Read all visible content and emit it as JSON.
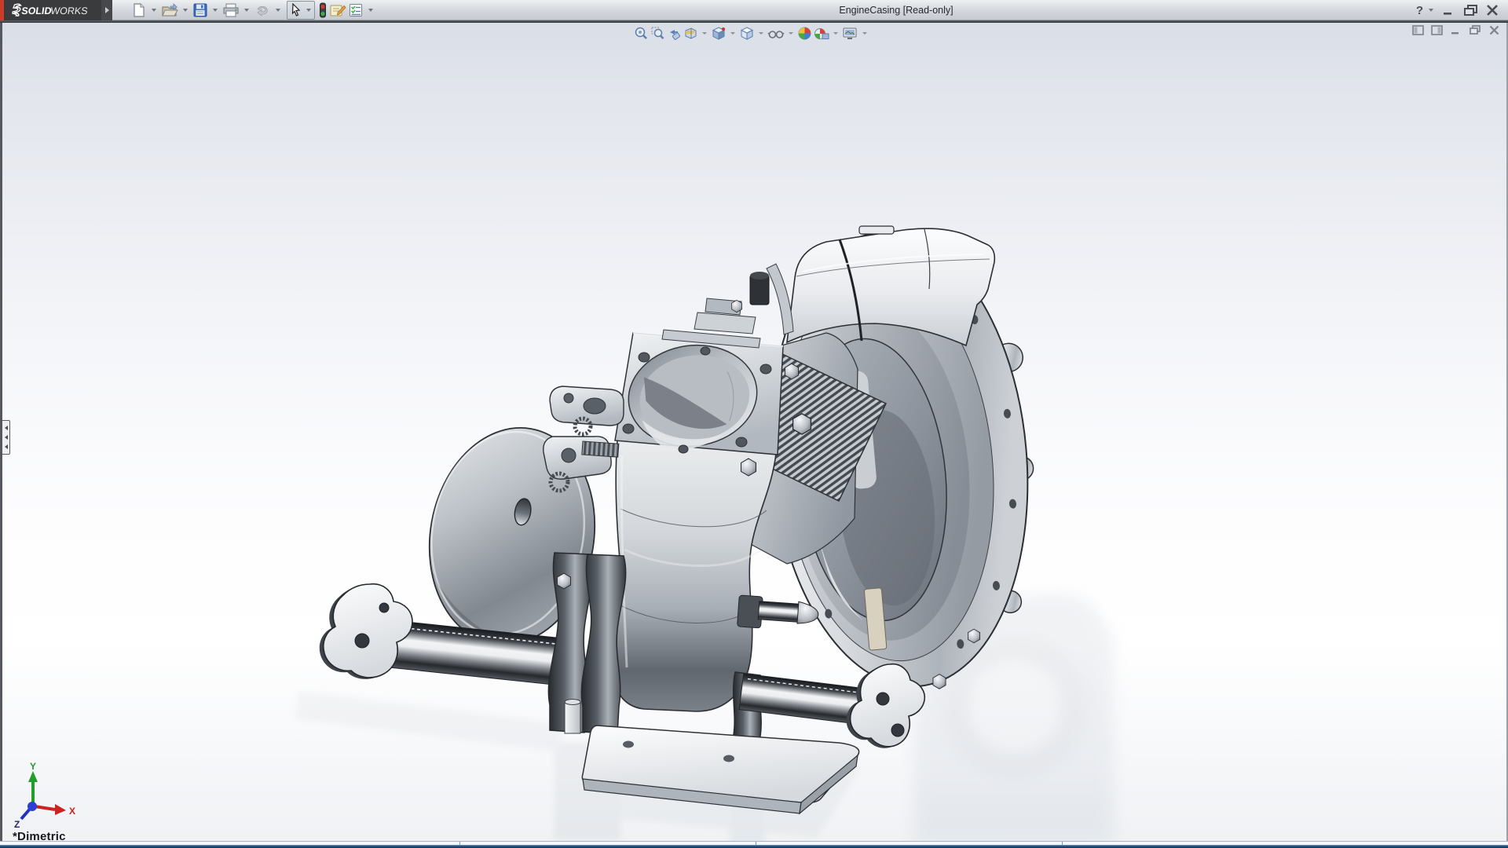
{
  "window": {
    "title": "EngineCasing [Read-only]",
    "logo": {
      "brand_bold": "SOLID",
      "brand_light": "WORKS"
    },
    "help_label": "?"
  },
  "toolbar_main": {
    "items": [
      "new-document",
      "open",
      "save",
      "print",
      "undo",
      "select",
      "design-checker",
      "comment",
      "design-binder"
    ]
  },
  "headsup_toolbar": {
    "items": [
      "zoom-to-fit",
      "zoom-to-area",
      "previous-view",
      "section-view",
      "view-orientation",
      "display-style",
      "hide-show-items",
      "edit-appearance",
      "apply-scene",
      "view-settings"
    ]
  },
  "document_controls": {
    "items": [
      "pane-left",
      "pane-right",
      "minimize-doc",
      "restore-doc",
      "close-doc"
    ]
  },
  "viewport": {
    "orientation_label": "*Dimetric",
    "triad": {
      "x": "X",
      "y": "Y",
      "z": "Z"
    },
    "model_name": "engine-casing-3d-model"
  },
  "colors": {
    "accent_red": "#cf3a27",
    "logo_bg": "#3a3b3d",
    "save_blue": "#3f6fc1",
    "triad_x": "#cc2222",
    "triad_y": "#1f9e28",
    "triad_z": "#2233bb",
    "status_strip_blue": "#36618f"
  }
}
